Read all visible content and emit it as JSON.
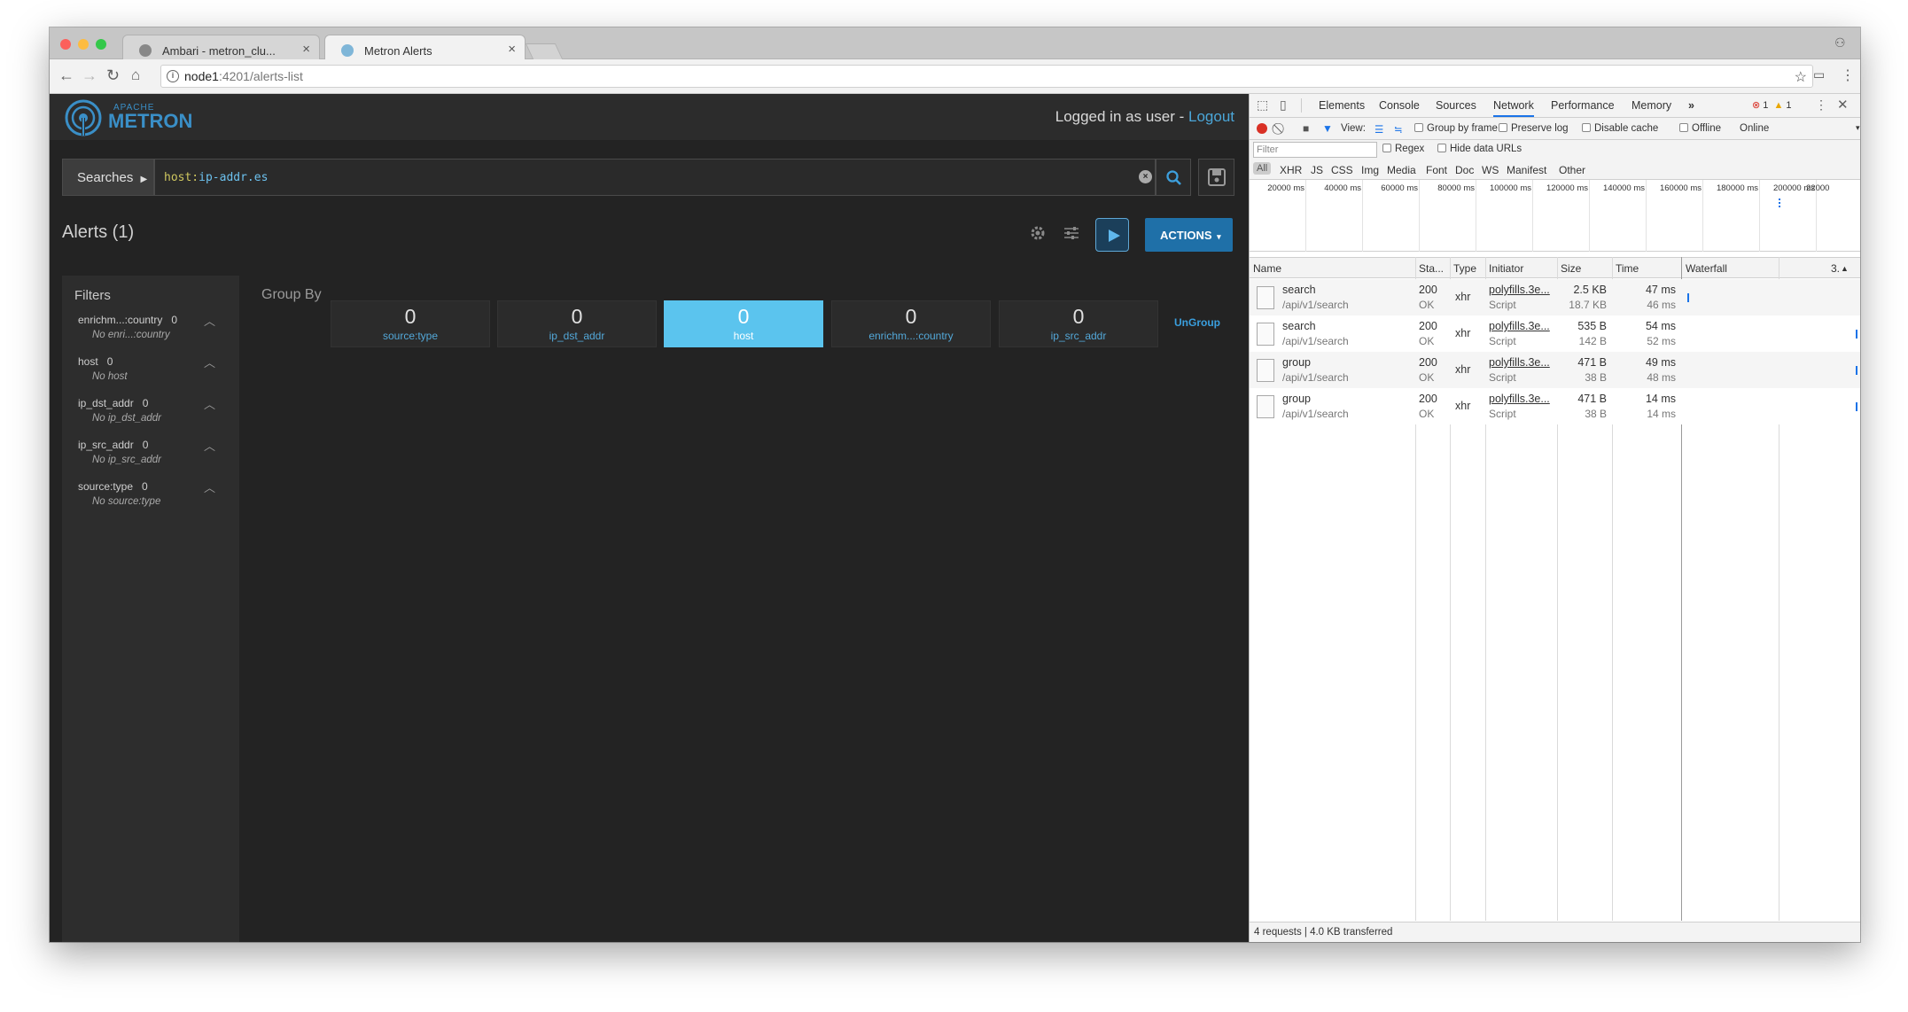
{
  "browser": {
    "tabs": [
      {
        "title": "Ambari - metron_clu..."
      },
      {
        "title": "Metron Alerts"
      }
    ],
    "url_host": "node1",
    "url_path": ":4201/alerts-list"
  },
  "app": {
    "logo": {
      "line1": "APACHE",
      "line2": "METRON"
    },
    "login_text": "Logged in as user - ",
    "logout_label": "Logout",
    "search": {
      "searches_label": "Searches",
      "query_key": "host:",
      "query_value": "ip-addr.es"
    },
    "alerts_title": "Alerts (1)",
    "actions_label": "ACTIONS",
    "filters": {
      "title": "Filters",
      "items": [
        {
          "label": "enrichm...:country",
          "count": "0",
          "empty": "No enri...:country"
        },
        {
          "label": "host",
          "count": "0",
          "empty": "No host"
        },
        {
          "label": "ip_dst_addr",
          "count": "0",
          "empty": "No ip_dst_addr"
        },
        {
          "label": "ip_src_addr",
          "count": "0",
          "empty": "No ip_src_addr"
        },
        {
          "label": "source:type",
          "count": "0",
          "empty": "No source:type"
        }
      ]
    },
    "group_by": {
      "label": "Group By",
      "ungroup_label": "UnGroup",
      "cards": [
        {
          "count": "0",
          "label": "source:type",
          "selected": false
        },
        {
          "count": "0",
          "label": "ip_dst_addr",
          "selected": false
        },
        {
          "count": "0",
          "label": "host",
          "selected": true
        },
        {
          "count": "0",
          "label": "enrichm...:country",
          "selected": false
        },
        {
          "count": "0",
          "label": "ip_src_addr",
          "selected": false
        }
      ]
    }
  },
  "devtools": {
    "tabs": [
      "Elements",
      "Console",
      "Sources",
      "Network",
      "Performance",
      "Memory"
    ],
    "active_tab": "Network",
    "error_count": "1",
    "warning_count": "1",
    "network_bar": {
      "view_label": "View:",
      "group_by_frame": "Group by frame",
      "preserve_log": "Preserve log",
      "disable_cache": "Disable cache",
      "offline": "Offline",
      "throttle": "Online"
    },
    "filter": {
      "placeholder": "Filter",
      "regex": "Regex",
      "hide_data_urls": "Hide data URLs"
    },
    "types": [
      "All",
      "XHR",
      "JS",
      "CSS",
      "Img",
      "Media",
      "Font",
      "Doc",
      "WS",
      "Manifest",
      "Other"
    ],
    "timeline_ticks": [
      "20000 ms",
      "40000 ms",
      "60000 ms",
      "80000 ms",
      "100000 ms",
      "120000 ms",
      "140000 ms",
      "160000 ms",
      "180000 ms",
      "200000 ms",
      "22000"
    ],
    "columns": {
      "name": "Name",
      "status": "Sta...",
      "type": "Type",
      "initiator": "Initiator",
      "size": "Size",
      "time": "Time",
      "waterfall": "Waterfall",
      "sort": "3."
    },
    "requests": [
      {
        "name": "search",
        "path": "/api/v1/search",
        "status": "200",
        "status_text": "OK",
        "type": "xhr",
        "initiator": "polyfills.3e...",
        "initiator_type": "Script",
        "size": "2.5 KB",
        "content": "18.7 KB",
        "time": "47 ms",
        "latency": "46 ms"
      },
      {
        "name": "search",
        "path": "/api/v1/search",
        "status": "200",
        "status_text": "OK",
        "type": "xhr",
        "initiator": "polyfills.3e...",
        "initiator_type": "Script",
        "size": "535 B",
        "content": "142 B",
        "time": "54 ms",
        "latency": "52 ms"
      },
      {
        "name": "group",
        "path": "/api/v1/search",
        "status": "200",
        "status_text": "OK",
        "type": "xhr",
        "initiator": "polyfills.3e...",
        "initiator_type": "Script",
        "size": "471 B",
        "content": "38 B",
        "time": "49 ms",
        "latency": "48 ms"
      },
      {
        "name": "group",
        "path": "/api/v1/search",
        "status": "200",
        "status_text": "OK",
        "type": "xhr",
        "initiator": "polyfills.3e...",
        "initiator_type": "Script",
        "size": "471 B",
        "content": "38 B",
        "time": "14 ms",
        "latency": "14 ms"
      }
    ],
    "footer": "4 requests | 4.0 KB transferred"
  }
}
